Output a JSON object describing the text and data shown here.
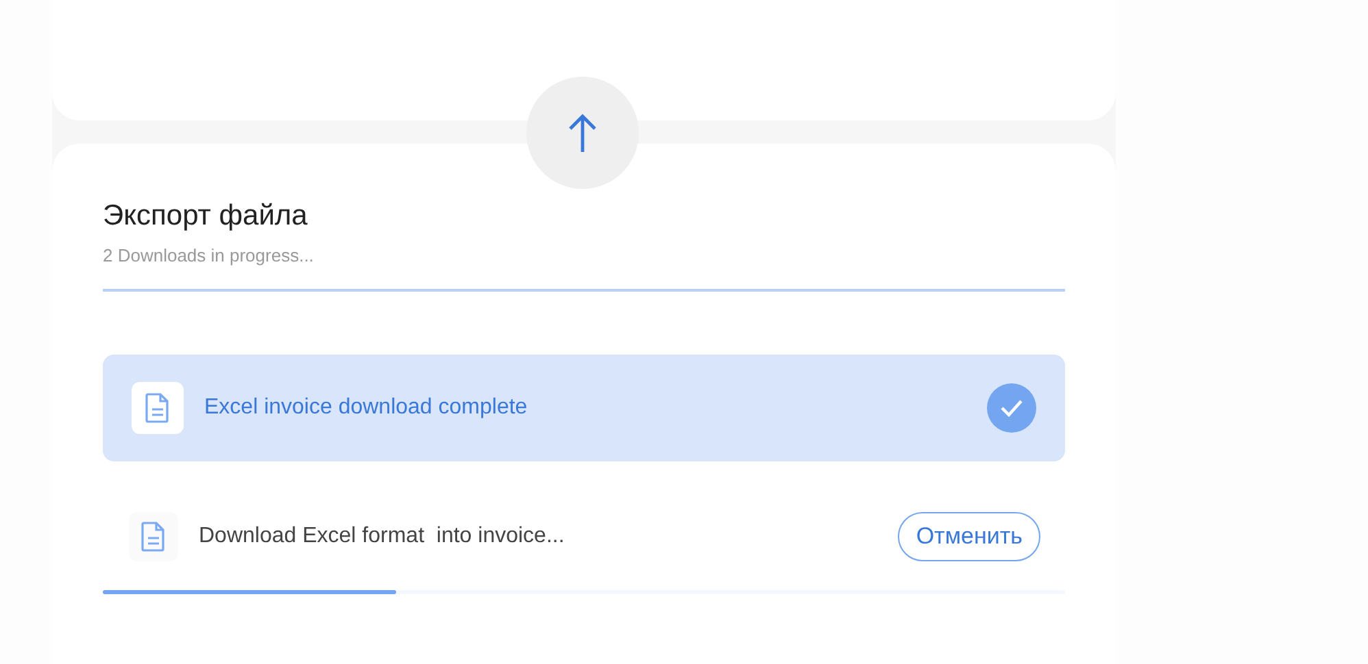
{
  "title": "Экспорт файла",
  "subtitle": "2 Downloads in progress...",
  "downloads": [
    {
      "kind": "complete",
      "label": "Excel invoice download complete"
    },
    {
      "kind": "in_progress",
      "label": "Download Excel format  into invoice...",
      "action": "Отменить",
      "level": 0.305
    }
  ]
}
